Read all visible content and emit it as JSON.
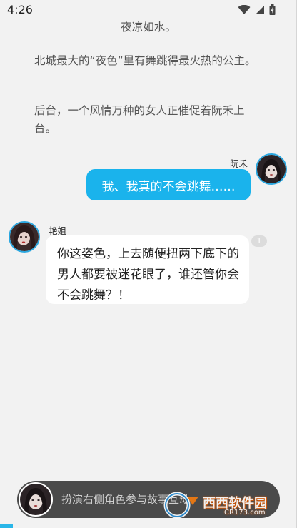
{
  "status_bar": {
    "time": "4:26",
    "icons": [
      "wifi-icon",
      "signal-icon",
      "battery-icon"
    ]
  },
  "story": {
    "narration": [
      "夜凉如水。",
      "北城最大的“夜色”里有舞跳得最火热的公主。",
      "后台，一个风情万种的女人正催促着阮禾上台。"
    ],
    "messages": [
      {
        "side": "right",
        "speaker": "阮禾",
        "text": "我、我真的不会跳舞……"
      },
      {
        "side": "left",
        "speaker": "艳姐",
        "text": "你这姿色，上去随便扭两下底下的男人都要被迷花眼了，谁还管你会不会跳舞？！",
        "badge": "1"
      }
    ]
  },
  "bottom_bar": {
    "prompt": "扮演右侧角色参与故事互动"
  },
  "watermark": {
    "text": "西西软件园",
    "sub": "CR173.com"
  },
  "colors": {
    "accent": "#1ab3ec",
    "background": "#f2f2f2",
    "bubble_left": "#ffffff",
    "bottom_bar": "#4a4a4a"
  }
}
